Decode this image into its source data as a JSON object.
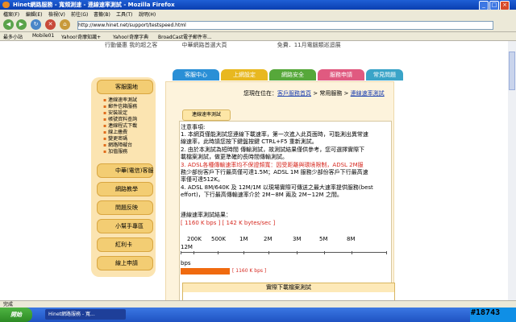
{
  "window": {
    "title": "Hinet網路服務 - 寬頻測速 - 連線速率測試 - Mozilla Firefox",
    "minimize": "_",
    "maximize": "□",
    "close": "×"
  },
  "menu": [
    "檔案(F)",
    "編輯(E)",
    "檢視(V)",
    "前往(G)",
    "書籤(B)",
    "工具(T)",
    "說明(H)"
  ],
  "nav": {
    "back": "◀",
    "forward": "▶",
    "reload": "↻",
    "stop": "✕",
    "home": "⌂",
    "url": "http://www.hinet.net/support/testspeed.html"
  },
  "bookmarks": [
    "最多小站",
    "Mobile01",
    "Yahoo!奇摩知識+",
    "Yahoo!奇摩字典",
    "Yahoo!奇摩字典",
    "BroadCast電子郵件市..."
  ],
  "page": {
    "top_strip": [
      "行動優惠 我的超之客",
      "中華網路首選大頁",
      "免費．11月電腦類巡迴展"
    ],
    "tabs": [
      {
        "label": "客服中心",
        "color": "#2a8fd6"
      },
      {
        "label": "上網設定",
        "color": "#e8b820"
      },
      {
        "label": "網路安全",
        "color": "#56a83a"
      },
      {
        "label": "服務申請",
        "color": "#e05a80"
      },
      {
        "label": "常見問題",
        "color": "#3aa4c8"
      }
    ],
    "sidebar": {
      "title": "客服園地",
      "items": [
        "連線速率測試",
        "郵件信箱服務",
        "安裝設定",
        "帳號資料查詢",
        "連線程式下載",
        "線上繳費",
        "變更密碼",
        "網路障礙台",
        "加值服務"
      ],
      "buttons": [
        "中華(電信)客服",
        "網路教學",
        "問題反映",
        "小幫手專區",
        "紅利卡",
        "線上申請"
      ]
    },
    "breadcrumb": {
      "prefix": "您現在位在：",
      "home": "客戶服務首頁",
      "sep1": " > ",
      "mid": "常用服務",
      "sep2": " > ",
      "current": "連線速率測試"
    },
    "section_tab": "連線速率測試",
    "notes": {
      "heading": "注意事項:",
      "l1": "1. 本網頁僅能測試您連線下載速率，第一次進入此頁面時，可能測出異常速",
      "l2": "線速率，此時請您按下鍵盤按鍵 CTRL+F5 重新測試。",
      "l3": "2. 由於本測試為短時間 傳輸測試，故測試結果僅供參考，您可選擇實際下",
      "l4": "載檔案測試，做更準確的長時間傳輸測試。",
      "l5": "3. ADSL各種傳輸速率均不保證頻寬：因受距離與環境限制，ADSL 2M服",
      "l6": "務少部份客戶下行最高僅可達1.5M；ADSL 1M 服務少部份客戶下行最高速",
      "l7": "率僅可達512K。",
      "l8": "4. ADSL 8M/640K 及 12M/1M 以現場實際可傳送之最大速率提供服務(best",
      "l9": "effort)，下行最高傳輸速率介於 2M~8M 兩及 2M~12M 之間。"
    },
    "result": {
      "label": "連線速率測試結果：",
      "value": "[ 1160 K bps ] [ 142 K bytes/sec ]"
    },
    "scale": [
      "200K",
      "500K",
      "1M",
      "2M",
      "3M",
      "5M",
      "8M"
    ],
    "scale_end": "12M",
    "unit": "bps",
    "speed_bar_label": "[ 1160 K bps ]",
    "table_title": "實際下載檔案測試"
  },
  "status": {
    "text": "完成"
  },
  "taskbar": {
    "start": "開始",
    "item": "Hinet網路服務 - 寬..."
  },
  "watermark": "#18743"
}
